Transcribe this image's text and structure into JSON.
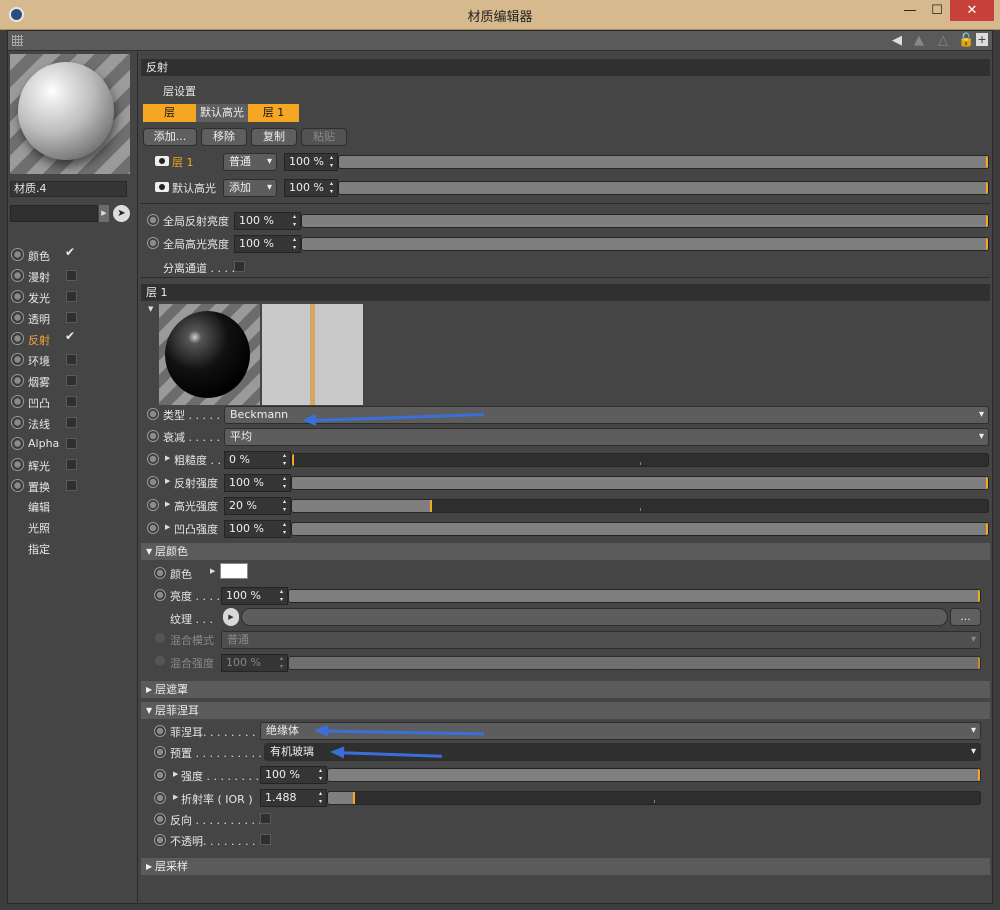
{
  "window": {
    "title": "材质编辑器",
    "minimize": "—",
    "maximize": "☐",
    "close": "✕"
  },
  "left": {
    "material_name": "材质.4",
    "channels": [
      {
        "label": "颜色",
        "checked": true,
        "active": false
      },
      {
        "label": "漫射",
        "checked": false,
        "active": false
      },
      {
        "label": "发光",
        "checked": false,
        "active": false
      },
      {
        "label": "透明",
        "checked": false,
        "active": false
      },
      {
        "label": "反射",
        "checked": true,
        "active": true
      },
      {
        "label": "环境",
        "checked": false,
        "active": false
      },
      {
        "label": "烟雾",
        "checked": false,
        "active": false
      },
      {
        "label": "凹凸",
        "checked": false,
        "active": false
      },
      {
        "label": "法线",
        "checked": false,
        "active": false
      },
      {
        "label": "Alpha",
        "checked": false,
        "active": false
      },
      {
        "label": "辉光",
        "checked": false,
        "active": false
      },
      {
        "label": "置换",
        "checked": false,
        "active": false
      }
    ],
    "extras": [
      "编辑",
      "光照",
      "指定"
    ]
  },
  "reflect": {
    "section_title": "反射",
    "layer_settings": "层设置",
    "tabs": [
      "层",
      "默认高光",
      "层 1"
    ],
    "buttons": {
      "add": "添加...",
      "remove": "移除",
      "copy": "复制",
      "paste": "粘贴"
    },
    "layers": [
      {
        "name": "层 1",
        "mode": "普通",
        "value": "100 %",
        "fraction": 1.0
      },
      {
        "name": "默认高光",
        "mode": "添加",
        "value": "100 %",
        "fraction": 1.0
      }
    ],
    "global_reflect": {
      "label": "全局反射亮度",
      "value": "100 %",
      "fraction": 1.0
    },
    "global_spec": {
      "label": "全局高光亮度",
      "value": "100 %",
      "fraction": 1.0
    },
    "separate": {
      "label": "分离通道 . . . ."
    }
  },
  "layer1": {
    "section_title": "层 1",
    "type": {
      "label": "类型 . . . . .",
      "value": "Beckmann"
    },
    "atten": {
      "label": "衰减 . . . . .",
      "value": "平均"
    },
    "roughness": {
      "label": "粗糙度 . .",
      "value": "0 %",
      "fraction": 0.0
    },
    "refl_strength": {
      "label": "反射强度",
      "value": "100 %",
      "fraction": 1.0
    },
    "spec_strength": {
      "label": "高光强度",
      "value": "20 %",
      "fraction": 0.2
    },
    "bump_strength": {
      "label": "凹凸强度",
      "value": "100 %",
      "fraction": 1.0
    }
  },
  "layer_color": {
    "title": "层颜色",
    "color": {
      "label": "颜色",
      "swatch": "#ffffff"
    },
    "brightness": {
      "label": "亮度 . . . .",
      "value": "100 %",
      "fraction": 1.0
    },
    "texture": {
      "label": "纹理 . . .",
      "more": "..."
    },
    "blend_mode": {
      "label": "混合模式",
      "value": "普通"
    },
    "blend_strength": {
      "label": "混合强度",
      "value": "100 %",
      "fraction": 1.0
    }
  },
  "layer_mask": {
    "title": "层遮罩"
  },
  "fresnel": {
    "title": "层菲涅耳",
    "fresnel": {
      "label": "菲涅耳. . . . . . . . .",
      "value": "绝缘体"
    },
    "preset": {
      "label": "预置 . . . . . . . . . . .",
      "value": "有机玻璃"
    },
    "strength": {
      "label": "强度 . . . . . . . . .",
      "value": "100 %",
      "fraction": 1.0
    },
    "ior": {
      "label": "折射率 ( IOR )",
      "value": "1.488",
      "fraction": 0.04
    },
    "invert": {
      "label": "反向 . . . . . . . . . . ."
    },
    "opaque": {
      "label": "不透明. . . . . . . . . ."
    }
  },
  "layer_sampling": {
    "title": "层采样"
  },
  "colors": {
    "accent": "#f5a623",
    "annotation_arrow": "#3b6fd8",
    "close_red": "#c7403a",
    "titlebar": "#d7b98e"
  }
}
